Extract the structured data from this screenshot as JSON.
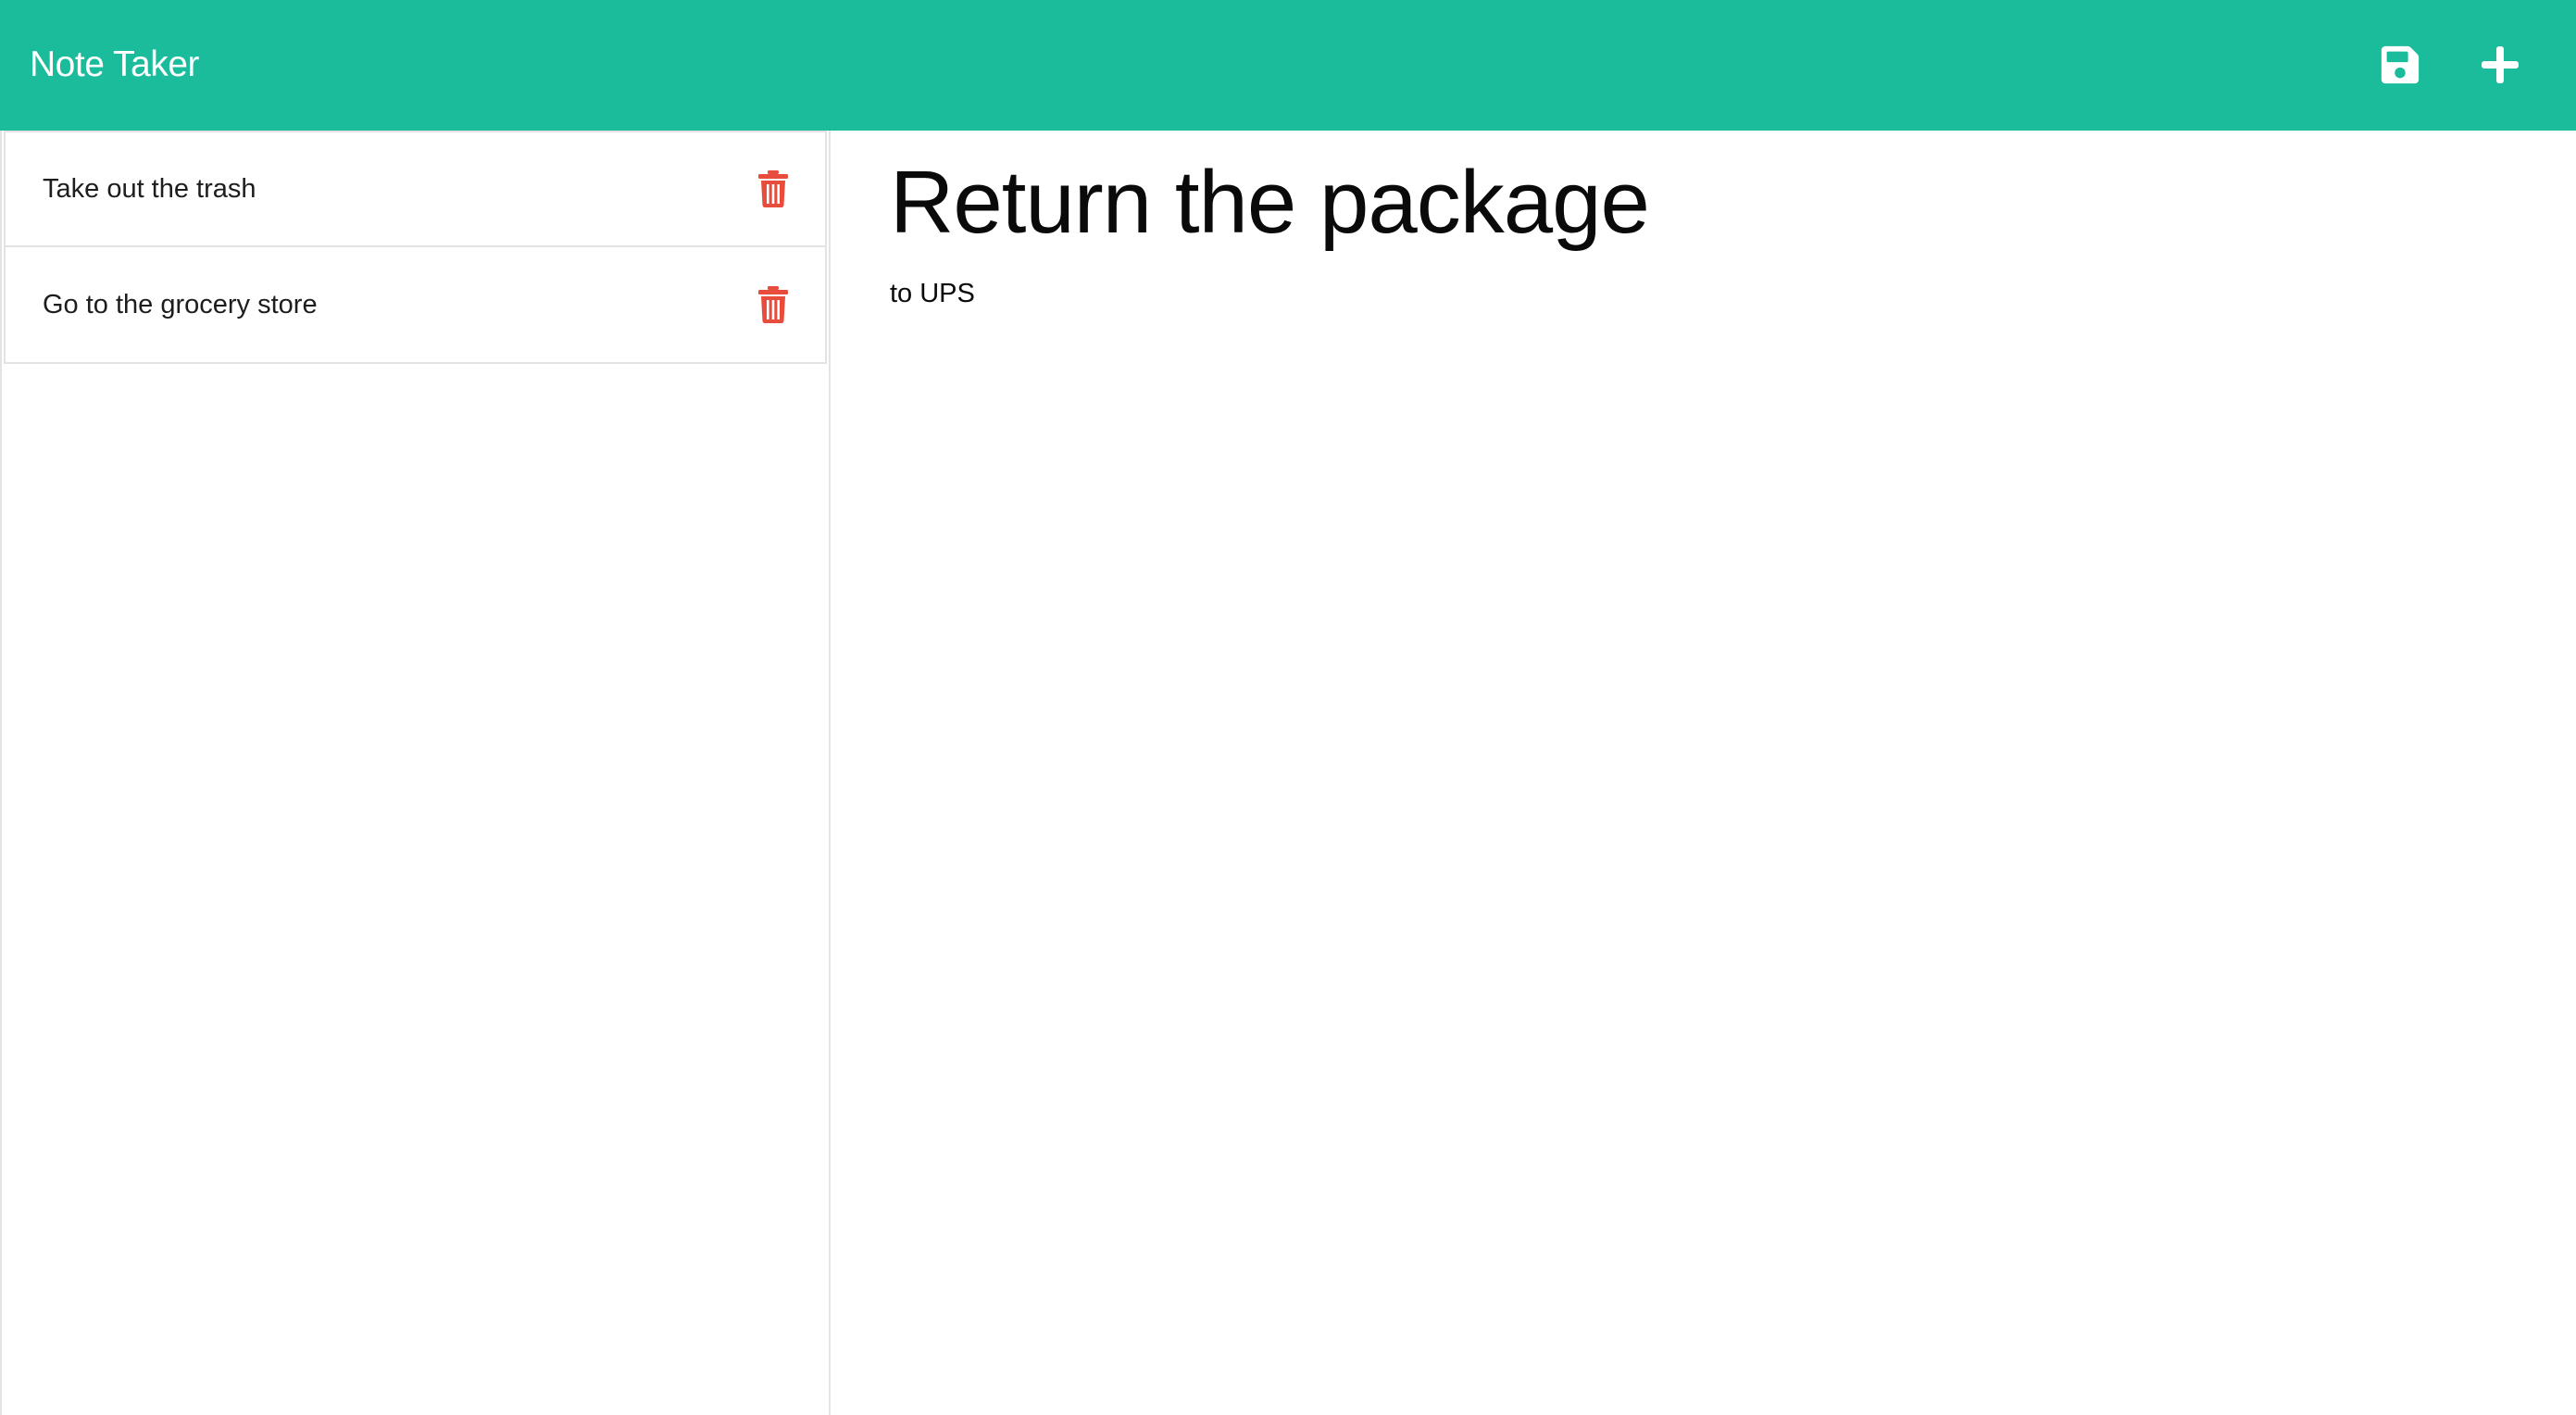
{
  "app": {
    "title": "Note Taker",
    "accent_color": "#1abc9c"
  },
  "toolbar": {
    "save_icon": "floppy-disk-icon",
    "add_icon": "plus-icon"
  },
  "notes": [
    {
      "title": "Take out the trash",
      "delete_icon": "trash-icon"
    },
    {
      "title": "Go to the grocery store",
      "delete_icon": "trash-icon"
    }
  ],
  "active_note": {
    "title": "Return the package",
    "text": "to UPS"
  },
  "colors": {
    "delete": "#e74c3c",
    "border": "#e3e3e3"
  }
}
